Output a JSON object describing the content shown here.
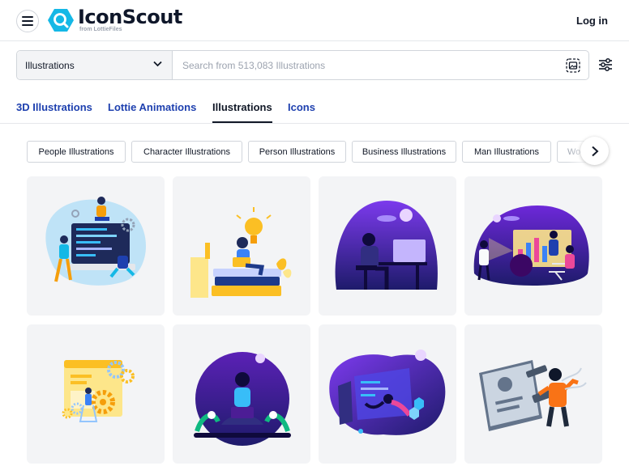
{
  "header": {
    "brand": "IconScout",
    "brand_sub": "from LottieFiles",
    "login_label": "Log in"
  },
  "search": {
    "type_value": "Illustrations",
    "placeholder": "Search from 513,083 Illustrations"
  },
  "tabs": [
    {
      "label": "3D Illustrations",
      "active": false
    },
    {
      "label": "Lottie Animations",
      "active": false
    },
    {
      "label": "Illustrations",
      "active": true
    },
    {
      "label": "Icons",
      "active": false
    }
  ],
  "chips": [
    {
      "label": "People Illustrations"
    },
    {
      "label": "Character Illustrations"
    },
    {
      "label": "Person Illustrations"
    },
    {
      "label": "Business Illustrations"
    },
    {
      "label": "Man Illustrations"
    },
    {
      "label": "Wo"
    }
  ],
  "colors": {
    "brand_blue": "#1e40af",
    "logo_cyan": "#14b8e6",
    "card_bg": "#f3f4f6",
    "purple": "#4c1d95"
  },
  "icons": [
    "hamburger-icon",
    "magnifier-logo-icon",
    "chevron-down-icon",
    "image-search-icon",
    "filter-sliders-icon",
    "chevron-right-icon"
  ],
  "results": [
    {
      "subject": "developer team at computer"
    },
    {
      "subject": "woman with laptop on books"
    },
    {
      "subject": "man at desk night"
    },
    {
      "subject": "business presentation"
    },
    {
      "subject": "web settings gears"
    },
    {
      "subject": "woman meditating with laptop"
    },
    {
      "subject": "woman flying through portal"
    },
    {
      "subject": "man with id card"
    }
  ]
}
